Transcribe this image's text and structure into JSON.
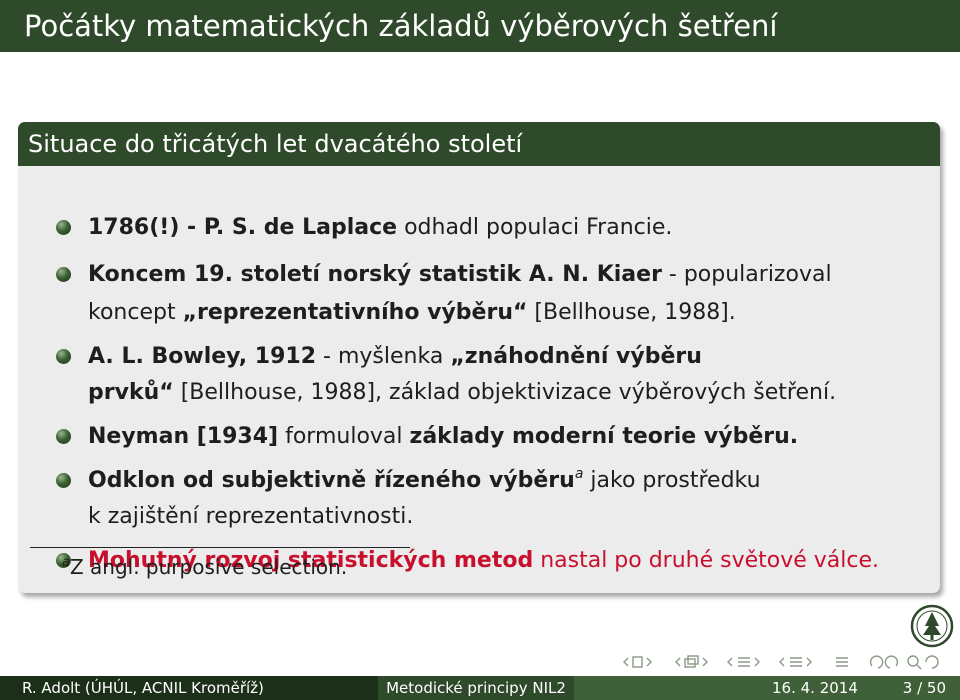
{
  "slide": {
    "title": "Počátky matematických základů výběrových šetření"
  },
  "block": {
    "title": "Situace do třicátých let dvacátého století",
    "items": [
      {
        "line1_bold": "1786(!) - P. S. de Laplace",
        "line1_rest": " odhadl populaci Francie."
      },
      {
        "line1_bold": "Koncem 19. století norský statistik A. N. Kiaer",
        "line1_rest": " - popularizoval",
        "line2_pre": "koncept ",
        "line2_bold": "„reprezentativního výběru“",
        "line2_post": " [Bellhouse, 1988]."
      },
      {
        "line1_bold": "A. L. Bowley, 1912",
        "line1_rest": " - myšlenka ",
        "line1_bold2": "„znáhodnění výběru",
        "line2_bold": "prvků“",
        "line2_post": " [Bellhouse, 1988], základ objektivizace výběrových šetření."
      },
      {
        "line1_bold": "Neyman [1934]",
        "line1_rest": " formuloval ",
        "line1_bold2": "základy moderní teorie výběru",
        "line1_end": "."
      },
      {
        "line1_bold": "Odklon od subjektivně řízeného výběru",
        "line1_sup": "a",
        "line1_rest": " jako prostředku",
        "line2_pre": "k zajištění reprezentativnosti."
      },
      {
        "line1_bold": "Mohutný rozvoj statistických metod",
        "line1_rest": " nastal po druhé světové válce."
      }
    ],
    "footnote": {
      "marker": "a",
      "text": "Z angl. purposive selection."
    }
  },
  "footer": {
    "author": "R. Adolt (ÚHÚL, ACNIL Kroměříž)",
    "talk_title": "Metodické principy NIL2",
    "date": "16. 4. 2014",
    "page": "3 / 50"
  },
  "colors": {
    "theme_green": "#2f4a2a",
    "footer_dark": "#1c3019",
    "footer_light": "#3f6038",
    "highlight_red": "#c8102e",
    "block_body": "#ececec"
  },
  "icons": [
    "institution-logo-icon",
    "beamer-navigation-icons"
  ]
}
